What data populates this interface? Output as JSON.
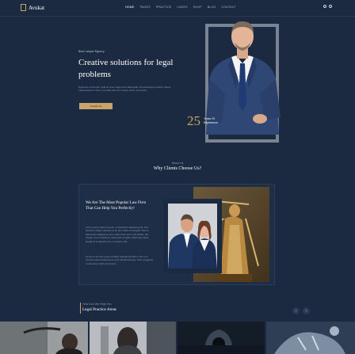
{
  "header": {
    "logo": "Avukat",
    "nav": [
      "HOME",
      "PAGES",
      "PRACTICE",
      "CASES",
      "SHOP",
      "BLOG",
      "CONTACT"
    ]
  },
  "hero": {
    "eyebrow": "Best Lawyer Egency",
    "title": "Creative solutions for legal problems",
    "text": "Dignissim commodo nulla sit amet magna dit malesuada. Et scelerisque porttitor mauris malesuada dui. Tortor, sit nulla odio sem neque. Enim cras turpis.",
    "button": "Contact Us",
    "years_number": "25",
    "years_label_1": "Years Of",
    "years_label_2": "Experience"
  },
  "why": {
    "eyebrow": "About Us",
    "title": "Why Clients Choose Us?"
  },
  "about": {
    "title": "We Are The Most Popular Law Firm That Can Help You Perfectly!",
    "para1": "Lorem ipsum dolor sit amet, consectetur adipiscing elit. Nec tincidunt nullam ridiculus et ac nisi mattis consequat. Sed ut. Maecenas adipiscing est ut diam dolor enim sed facilisi, nisl. Integer id et id lectus at maecenas fringilla. Adipiscing turpis feugiat id at aliquam orci, a ultrices odio.",
    "para2": "Lectus et at nunc quam sodales gravida interdum. Nec non posuere lacus pharetra est enim blandit semper. Nunc feugiat at ut senectus mollis urna lacus."
  },
  "practice": {
    "eyebrow": "How Can We Help You",
    "title": "Legal Practice Areas",
    "prev": "‹",
    "next": "›"
  },
  "colors": {
    "background": "#1b2a41",
    "accent": "#c9a46a"
  }
}
